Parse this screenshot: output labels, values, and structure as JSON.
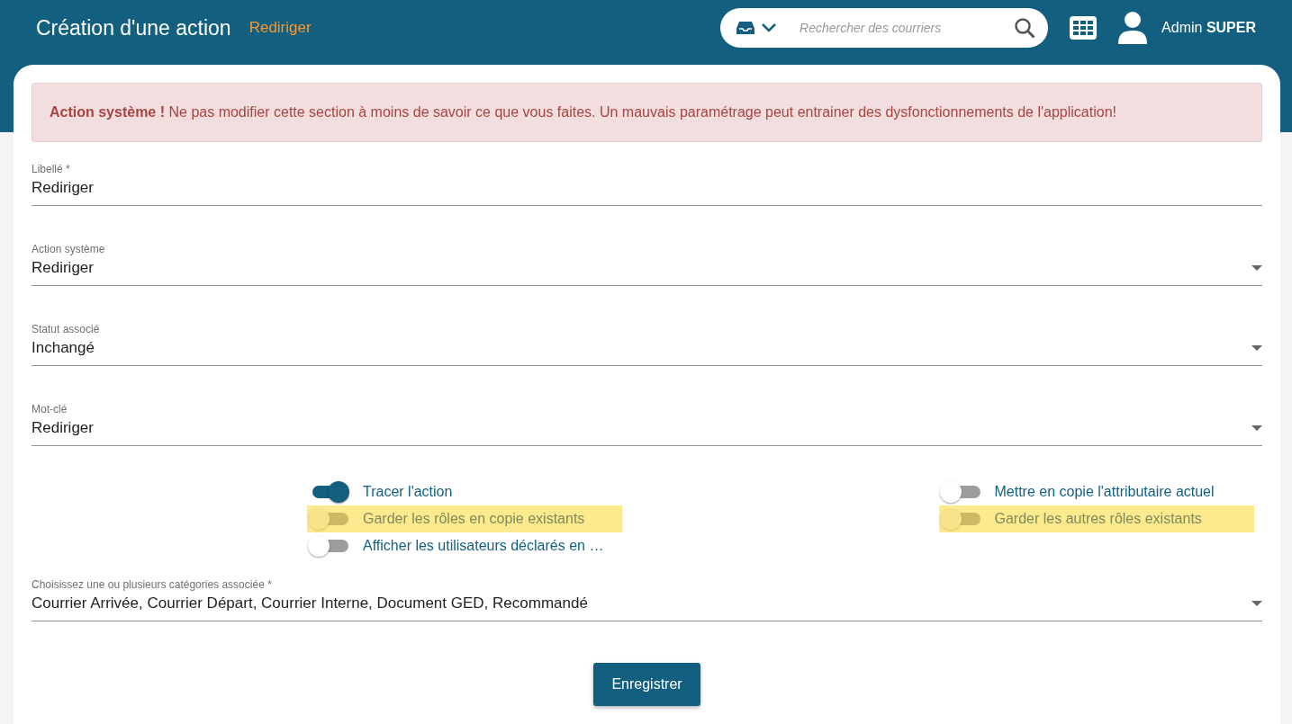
{
  "header": {
    "title": "Création d'une action",
    "subtitle": "Rediriger",
    "search": {
      "placeholder": "Rechercher des courriers"
    },
    "user": {
      "first": "Admin",
      "last": "SUPER"
    }
  },
  "alert": {
    "text": "**Action système !** Ne pas modifier cette section à moins de savoir ce que vous faites. Un mauvais paramétrage peut entrainer des dysfonctionnements de l'application!"
  },
  "fields": [
    {
      "kind": "text",
      "label": "Libellé *",
      "value": "Rediriger"
    },
    {
      "kind": "select",
      "label": "Action système",
      "value": "Rediriger"
    },
    {
      "kind": "select",
      "label": "Statut associé",
      "value": "Inchangé"
    },
    {
      "kind": "select",
      "label": "Mot-clé",
      "value": "Rediriger"
    }
  ],
  "toggles_left": [
    {
      "label": "Tracer l'action",
      "on": true,
      "highlighted": false
    },
    {
      "label": "Garder les rôles en copie existants",
      "on": false,
      "highlighted": true
    },
    {
      "label": "Afficher les utilisateurs déclarés en …",
      "on": false,
      "highlighted": false
    }
  ],
  "toggles_right": [
    {
      "label": "Mettre en copie l'attributaire actuel",
      "on": false,
      "highlighted": false
    },
    {
      "label": "Garder les autres rôles existants",
      "on": false,
      "highlighted": true
    }
  ],
  "categories": {
    "label": "Choisissez une ou plusieurs catégories associée *",
    "value": "Courrier Arrivée, Courrier Départ, Courrier Interne, Document GED, Recommandé"
  },
  "save_button": "Enregistrer"
}
